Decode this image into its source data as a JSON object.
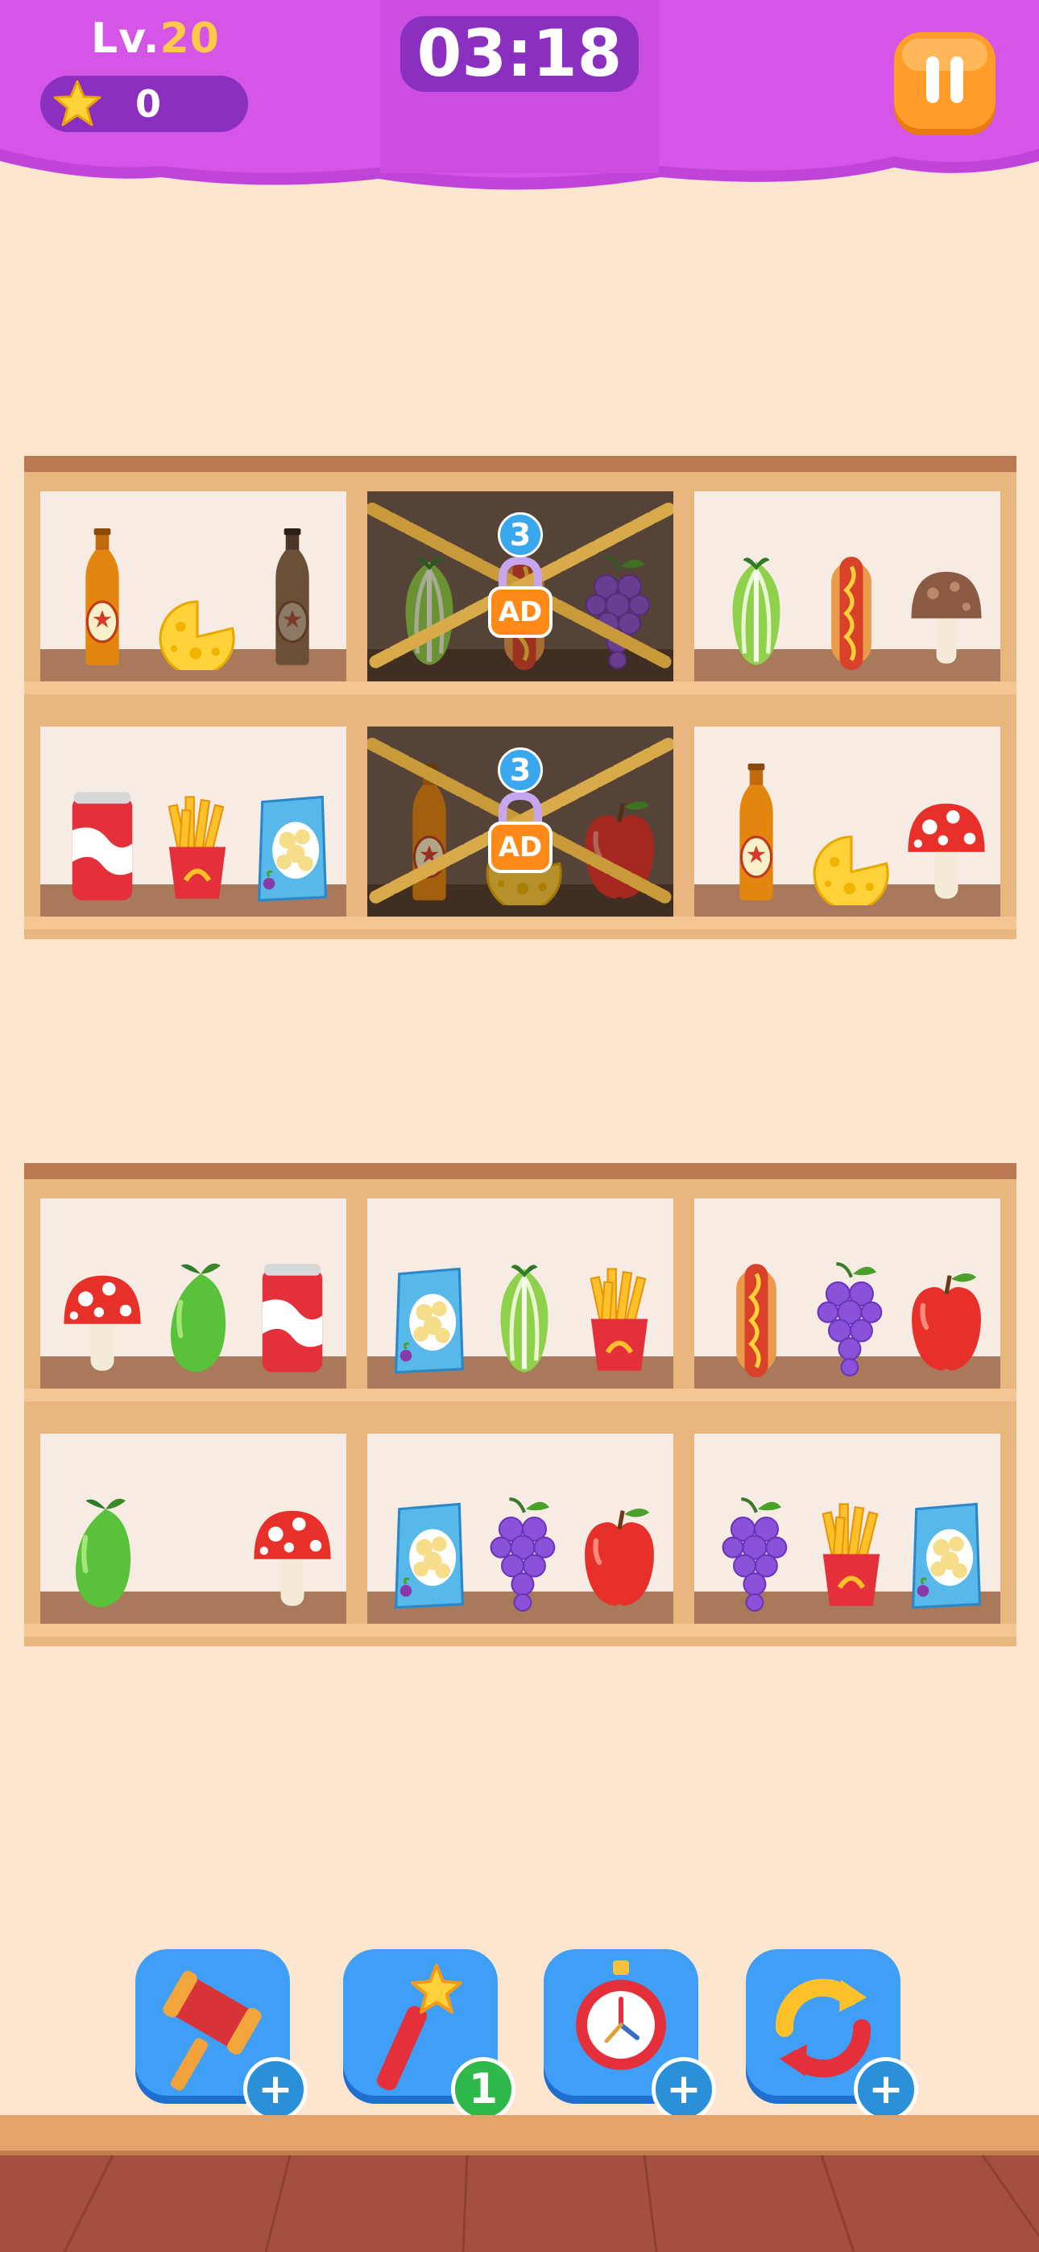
{
  "header": {
    "level_prefix": "Lv.",
    "level_number": "20",
    "star_count": "0",
    "timer": "03:18",
    "pause_icon": "pause-icon"
  },
  "lock_overlay": {
    "count": "3",
    "label": "AD"
  },
  "shelf_units": [
    {
      "rows": [
        {
          "cells": [
            {
              "locked": false,
              "items": [
                "beer-bottle",
                "cheese",
                "dark-beer-bottle"
              ]
            },
            {
              "locked": true,
              "items": [
                "lettuce",
                "hotdog",
                "grapes"
              ]
            },
            {
              "locked": false,
              "items": [
                "lettuce",
                "hotdog",
                "mushroom"
              ]
            }
          ]
        },
        {
          "cells": [
            {
              "locked": false,
              "items": [
                "soda-can",
                "french-fries",
                "chips-bag"
              ]
            },
            {
              "locked": true,
              "items": [
                "beer-bottle",
                "cheese",
                "apple"
              ]
            },
            {
              "locked": false,
              "items": [
                "beer-bottle",
                "cheese",
                "mushroom"
              ]
            }
          ]
        }
      ]
    },
    {
      "rows": [
        {
          "cells": [
            {
              "locked": false,
              "items": [
                "mushroom",
                "mango",
                "soda-can"
              ]
            },
            {
              "locked": false,
              "items": [
                "chips-bag",
                "lettuce",
                "french-fries"
              ]
            },
            {
              "locked": false,
              "items": [
                "hotdog",
                "grapes",
                "apple"
              ]
            }
          ]
        },
        {
          "cells": [
            {
              "locked": false,
              "items": [
                "mango",
                "",
                "mushroom"
              ]
            },
            {
              "locked": false,
              "items": [
                "chips-bag",
                "grapes",
                "apple"
              ]
            },
            {
              "locked": false,
              "items": [
                "grapes",
                "french-fries",
                "chips-bag"
              ]
            }
          ]
        }
      ]
    }
  ],
  "tools": [
    {
      "name": "hammer",
      "icon": "hammer-icon",
      "badge": "+",
      "badge_type": "plus"
    },
    {
      "name": "magic-wand",
      "icon": "magic-wand-icon",
      "badge": "1",
      "badge_type": "count"
    },
    {
      "name": "stopwatch",
      "icon": "stopwatch-icon",
      "badge": "+",
      "badge_type": "plus"
    },
    {
      "name": "shuffle",
      "icon": "shuffle-icon",
      "badge": "+",
      "badge_type": "plus"
    }
  ],
  "colors": {
    "header_purple": "#d455e6",
    "header_dark": "#8a2fc0",
    "pause_orange": "#ff9c2a",
    "background": "#fde6cf",
    "wood": "#e9b67f",
    "tool_blue": "#3f9ef5",
    "badge_blue": "#2a90d8",
    "badge_green": "#2fb94a"
  }
}
